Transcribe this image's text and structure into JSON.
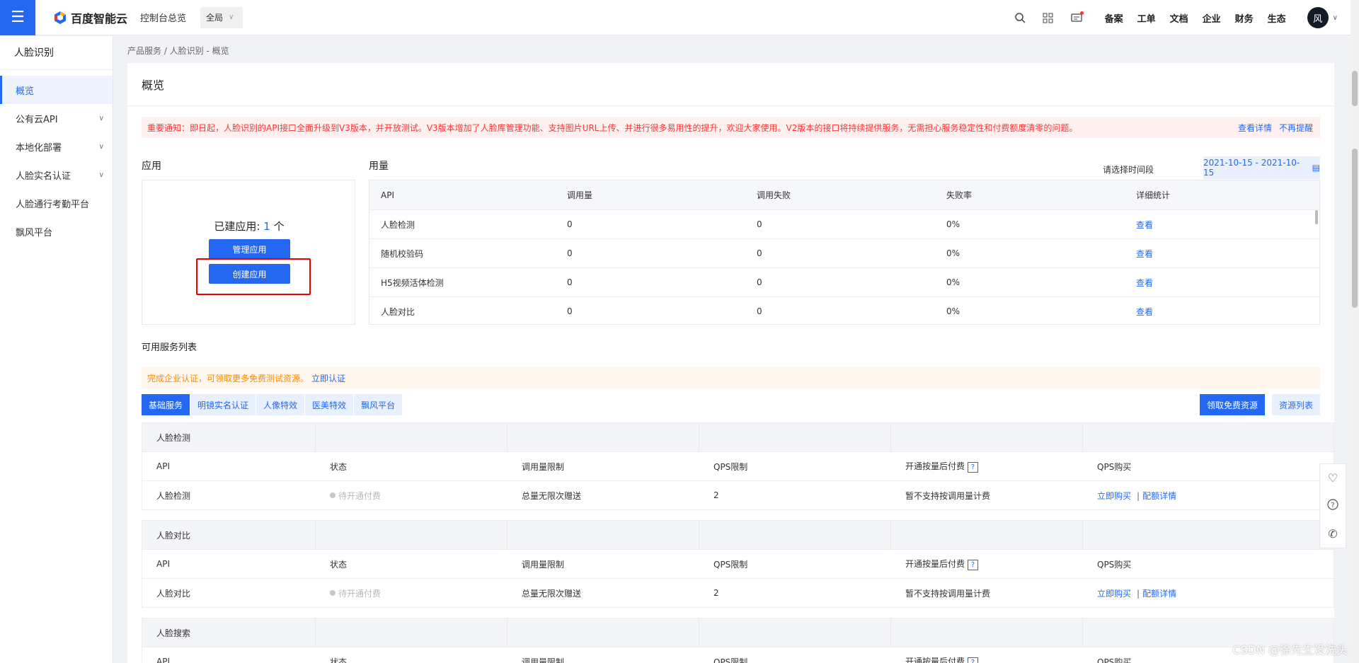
{
  "topbar": {
    "menu_icon": "hamburger-menu-icon",
    "brand": "百度智能云",
    "console": "控制台总览",
    "region": "全局",
    "links": [
      "备案",
      "工单",
      "文档",
      "企业",
      "财务",
      "生态"
    ],
    "avatar": "风"
  },
  "sidebar": {
    "title": "人脸识别",
    "items": [
      {
        "label": "概览"
      },
      {
        "label": "公有云API"
      },
      {
        "label": "本地化部署"
      },
      {
        "label": "人脸实名认证"
      },
      {
        "label": "人脸通行考勤平台"
      },
      {
        "label": "飘风平台"
      }
    ]
  },
  "breadcrumb": "产品服务 / 人脸识别 - 概览",
  "page_title": "概览",
  "notice": {
    "text": "重要通知：即日起，人脸识别的API接口全面升级到V3版本，并开放测试。V3版本增加了人脸库管理功能、支持图片URL上传、并进行很多易用性的提升，欢迎大家使用。V2版本的接口将持续提供服务，无需担心服务稳定性和付费额度清零的问题。",
    "details_link": "查看详情",
    "dismiss_link": "不再提醒"
  },
  "app": {
    "label": "应用",
    "count_prefix": "已建应用: ",
    "count": "1",
    "count_suffix": " 个",
    "manage_button": "管理应用",
    "create_button": "创建应用"
  },
  "usage": {
    "label": "用量",
    "date_label": "请选择时间段",
    "date_range": "2021-10-15 - 2021-10-15",
    "columns": [
      "API",
      "调用量",
      "调用失败",
      "失败率",
      "详细统计"
    ],
    "rows": [
      {
        "api": "人脸检测",
        "calls": "0",
        "fails": "0",
        "rate": "0%",
        "link": "查看"
      },
      {
        "api": "随机校验码",
        "calls": "0",
        "fails": "0",
        "rate": "0%",
        "link": "查看"
      },
      {
        "api": "H5视频活体检测",
        "calls": "0",
        "fails": "0",
        "rate": "0%",
        "link": "查看"
      },
      {
        "api": "人脸对比",
        "calls": "0",
        "fails": "0",
        "rate": "0%",
        "link": "查看"
      }
    ]
  },
  "services": {
    "label": "可用服务列表",
    "promo_text": "完成企业认证，可领取更多免费测试资源。",
    "promo_link": "立即认证",
    "tabs": [
      "基础服务",
      "明镜实名认证",
      "人像特效",
      "医美特效",
      "飘风平台"
    ],
    "free_button": "领取免费资源",
    "list_button": "资源列表",
    "columns": [
      "API",
      "状态",
      "调用量限制",
      "QPS限制",
      "开通按量后付费",
      "QPS购买"
    ],
    "groups": [
      {
        "name": "人脸检测",
        "api": "人脸检测",
        "status": "待开通付费",
        "limit": "总量无限次赠送",
        "qps": "2",
        "postpay": "暂不支持按调用量计费",
        "buy": "立即购买",
        "detail": "配额详情"
      },
      {
        "name": "人脸对比",
        "api": "人脸对比",
        "status": "待开通付费",
        "limit": "总量无限次赠送",
        "qps": "2",
        "postpay": "暂不支持按调用量计费",
        "buy": "立即购买",
        "detail": "配额详情"
      },
      {
        "name": "人脸搜索"
      }
    ]
  },
  "float_icons": [
    "heart-icon",
    "help-icon",
    "phone-icon"
  ],
  "watermark": "CSDN @徐先生没洗头"
}
